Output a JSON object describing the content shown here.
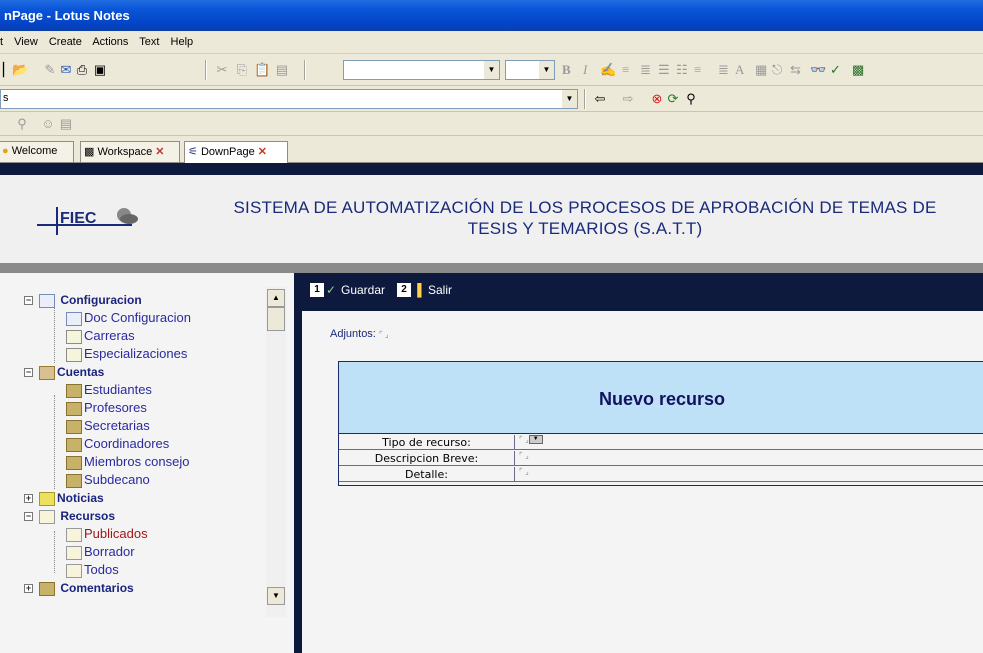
{
  "window": {
    "title": "nPage - Lotus Notes"
  },
  "menu": [
    "t",
    "View",
    "Create",
    "Actions",
    "Text",
    "Help"
  ],
  "address": {
    "value": "s"
  },
  "tabs": [
    {
      "label": "Welcome",
      "close": ""
    },
    {
      "label": "Workspace",
      "close": "✕"
    },
    {
      "label": "DownPage",
      "close": "✕",
      "active": true
    }
  ],
  "header": {
    "logo_text": "FIEC",
    "title_line1": "SISTEMA DE AUTOMATIZACIÓN DE LOS PROCESOS DE APROBACIÓN DE TEMAS DE",
    "title_line2": "TESIS Y TEMARIOS (S.A.T.T)"
  },
  "nav": {
    "groups": [
      {
        "label": "Configuracion",
        "expander": "⊟",
        "items": [
          "Doc Configuracion",
          "Carreras",
          "Especializaciones"
        ]
      },
      {
        "label": "Cuentas",
        "expander": "⊟",
        "items": [
          "Estudiantes",
          "Profesores",
          "Secretarias",
          "Coordinadores",
          "Miembros consejo",
          "Subdecano"
        ]
      },
      {
        "label": "Noticias",
        "expander": "⊞",
        "items": []
      },
      {
        "label": "Recursos",
        "expander": "⊟",
        "items": [
          "Publicados",
          "Borrador",
          "Todos"
        ],
        "active_item": "Publicados"
      },
      {
        "label": "Comentarios",
        "expander": "⊞",
        "items": []
      }
    ]
  },
  "actions": [
    {
      "num": "1",
      "label": "Guardar"
    },
    {
      "num": "2",
      "label": "Salir"
    }
  ],
  "form": {
    "adjuntos_label": "Adjuntos:",
    "title": "Nuevo recurso",
    "fields": [
      {
        "label": "Tipo de recurso:",
        "has_dropdown": true
      },
      {
        "label": "Descripcion Breve:",
        "has_dropdown": false
      },
      {
        "label": "Detalle:",
        "has_dropdown": false
      }
    ]
  },
  "colors": {
    "titlebar": "#0443c5",
    "nav_dark": "#0d1a3d",
    "form_header": "#bfe1f8",
    "title_text": "#1a2a7a"
  }
}
